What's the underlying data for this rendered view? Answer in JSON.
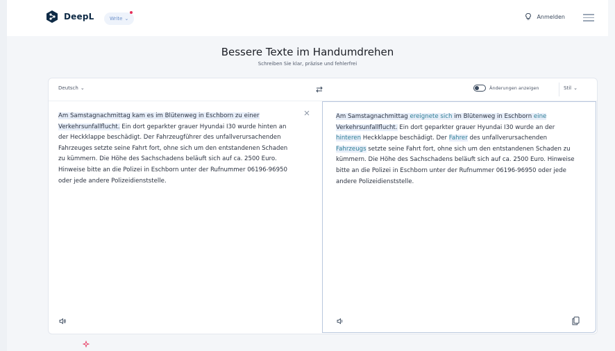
{
  "header": {
    "brand": "DeepL",
    "write_pill": "Write",
    "login_label": "Anmelden"
  },
  "hero": {
    "title": "Bessere Texte im Handumdrehen",
    "subtitle": "Schreiben Sie klar, präzise und fehlerfrei"
  },
  "toolbar": {
    "source_language": "Deutsch",
    "show_changes_label": "Änderungen anzeigen",
    "style_label": "Stil"
  },
  "source": {
    "segments": [
      {
        "text": "Am Samstagnachmittag kam es im Blütenweg in Eschborn zu einer Verkehrsunfallflucht.",
        "hl": true
      },
      {
        "text": " Ein dort geparkter grauer Hyundai I30 wurde hinten an der Heckklappe beschädigt. Der Fahrzeugführer des unfallverursachenden Fahrzeuges setzte seine Fahrt fort, ohne sich um den entstandenen Schaden zu kümmern. Die Höhe des Sachschadens beläuft sich auf ca. 2500 Euro. Hinweise bitte an die Polizei in Eschborn unter der Rufnummer 06196-96950 oder jede andere Polizeidienststelle.",
        "hl": false
      }
    ]
  },
  "result": {
    "segments": [
      {
        "text": "Am Samstagnachmittag ",
        "type": "hl"
      },
      {
        "text": "ereignete sich",
        "type": "chg"
      },
      {
        "text": " im Blütenweg in Eschborn ",
        "type": "hl"
      },
      {
        "text": "eine",
        "type": "chg"
      },
      {
        "text": " Verkehrsunfallflucht.",
        "type": "hl"
      },
      {
        "text": " Ein dort geparkter grauer Hyundai I30 wurde an der ",
        "type": "plain"
      },
      {
        "text": "hinteren",
        "type": "chg"
      },
      {
        "text": " Heckklappe beschädigt. Der ",
        "type": "plain"
      },
      {
        "text": "Fahrer",
        "type": "chg"
      },
      {
        "text": " des unfallverursachenden ",
        "type": "plain"
      },
      {
        "text": "Fahrzeugs",
        "type": "chg"
      },
      {
        "text": " setzte seine Fahrt fort, ohne sich um den entstandenen Schaden zu kümmern. Die Höhe des Sachschadens beläuft sich auf ca. 2500 Euro. Hinweise bitte an die Polizei in Eschborn unter der Rufnummer 06196-96950 oder jede andere Polizeidienststelle.",
        "type": "plain"
      }
    ]
  },
  "colors": {
    "accent": "#0f2b46",
    "highlight": "#e7eef9",
    "change_text": "#2f7f95",
    "notification_dot": "#e6305a"
  },
  "icons": [
    "deepl-logo-icon",
    "lightbulb-icon",
    "menu-icon",
    "swap-icon",
    "close-icon",
    "speaker-icon",
    "copy-icon",
    "chevron-down-icon"
  ]
}
